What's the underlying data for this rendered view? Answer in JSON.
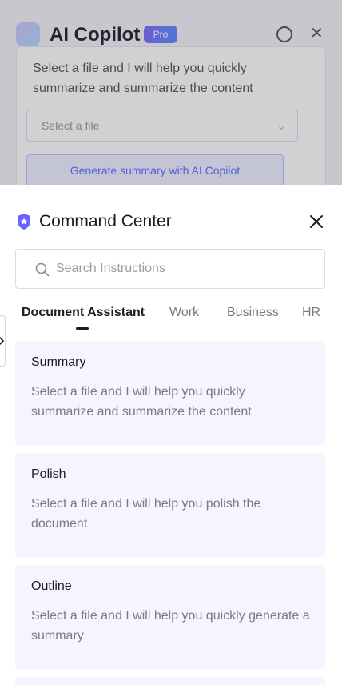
{
  "background_app": {
    "title": "AI Copilot",
    "badge": "Pro",
    "description": "Select a file and I will help you quickly summarize and summarize the content",
    "select_placeholder": "Select a file",
    "action_label": "Generate summary with AI Copilot"
  },
  "drawer": {
    "title": "Command Center",
    "title_icon": "shield-icon",
    "close_icon": "close-icon",
    "search": {
      "placeholder": "Search Instructions",
      "value": ""
    },
    "tabs": [
      {
        "label": "Document Assistant",
        "active": true
      },
      {
        "label": "Work",
        "active": false
      },
      {
        "label": "Business",
        "active": false
      },
      {
        "label": "HR",
        "active": false
      }
    ],
    "cards": [
      {
        "title": "Summary",
        "description": "Select a file and I will help you quickly summarize and summarize the content"
      },
      {
        "title": "Polish",
        "description": "Select a file and I will help you polish the document"
      },
      {
        "title": "Outline",
        "description": "Select a file and I will help you quickly generate a summary"
      }
    ]
  },
  "colors": {
    "accent": "#6c63ff",
    "card_bg": "#f6f5ff",
    "text_primary": "#1c1c1e",
    "text_secondary": "#7a7a82"
  }
}
